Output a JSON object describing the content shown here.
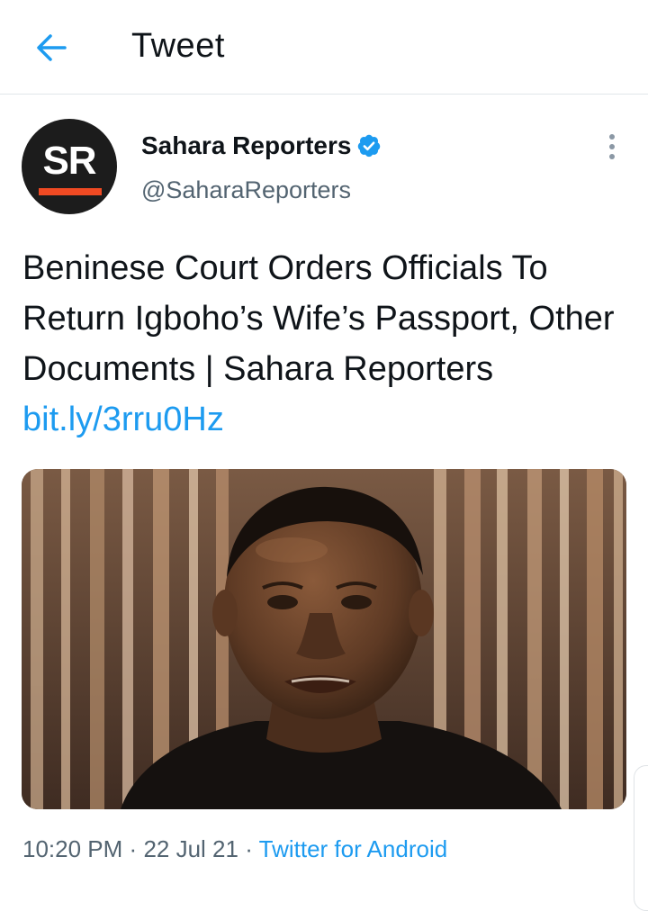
{
  "header": {
    "title": "Tweet"
  },
  "author": {
    "avatar_text": "SR",
    "name": "Sahara Reporters",
    "handle": "@SaharaReporters"
  },
  "tweet": {
    "text": "Beninese Court Orders Officials To Return Igboho’s Wife’s Passport, Other Documents | Sahara Reporters",
    "link": "bit.ly/3rru0Hz"
  },
  "meta": {
    "time": "10:20 PM",
    "separator": "·",
    "date": "22 Jul 21",
    "source": "Twitter for Android"
  },
  "colors": {
    "accent": "#1d9bf0",
    "text": "#0f1419",
    "secondary": "#536471",
    "avatar_bg": "#1c1c1c",
    "avatar_bar": "#f04a23"
  },
  "icons": {
    "back": "arrow-left-icon",
    "verified": "verified-badge-icon",
    "more": "more-vertical-icon"
  }
}
